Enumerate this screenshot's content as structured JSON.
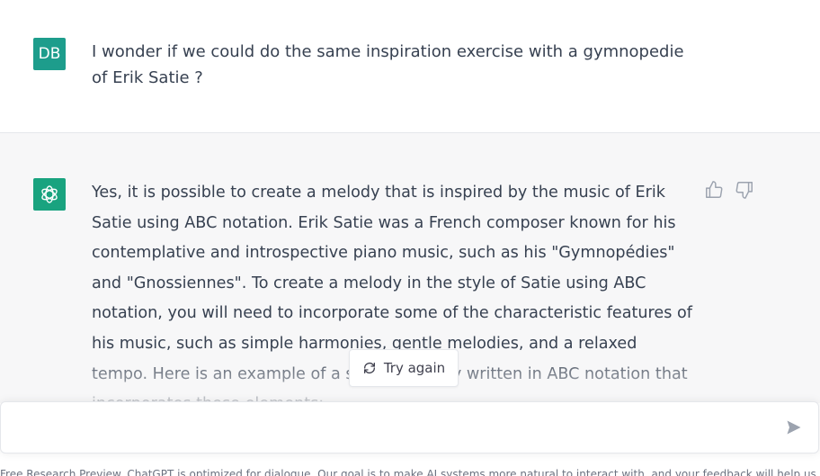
{
  "user": {
    "avatar_initials": "DB",
    "message": "I wonder if we could do the same inspiration exercise with a gymnopedie of Erik Satie ?"
  },
  "assistant": {
    "avatar_icon": "openai-logo-icon",
    "message": "Yes, it is possible to create a melody that is inspired by the music of Erik Satie using ABC notation. Erik Satie was a French composer known for his contemplative and introspective piano music, such as his \"Gymnopédies\" and \"Gnossiennes\". To create a melody in the style of Satie using ABC notation, you will need to incorporate some of the characteristic features of his music, such as simple harmonies, gentle melodies, and a relaxed tempo. Here is an example of a simple melody written in ABC notation that incorporates these elements:",
    "feedback": {
      "thumbs_up_icon": "thumbs-up-icon",
      "thumbs_down_icon": "thumbs-down-icon"
    }
  },
  "try_again": {
    "label": "Try again",
    "icon": "refresh-icon"
  },
  "composer": {
    "placeholder": "",
    "send_icon": "send-icon"
  },
  "footer": {
    "text": "Free Research Preview. ChatGPT is optimized for dialogue. Our goal is to make AI systems more natural to interact with, and your feedback will help us improve our systems and make them safer."
  },
  "colors": {
    "user_avatar": "#1d9d8c",
    "assistant_avatar": "#19a37f",
    "assistant_bg": "#f7f7f8",
    "text": "#374151"
  }
}
